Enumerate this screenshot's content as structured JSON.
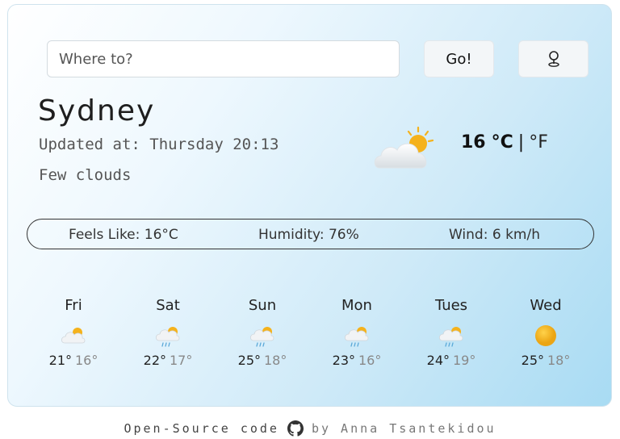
{
  "search": {
    "placeholder": "Where to?",
    "go_label": "Go!",
    "location_icon": "map-pin-icon"
  },
  "current": {
    "city": "Sydney",
    "updated": "Updated at: Thursday 20:13",
    "description": "Few clouds",
    "icon": "partly-cloudy-icon",
    "temperature": "16",
    "unit_celsius": "°C",
    "separator": "|",
    "unit_fahrenheit": "°F"
  },
  "details": {
    "feels_like": "Feels Like: 16°C",
    "humidity": "Humidity: 76%",
    "wind": "Wind: 6 km/h"
  },
  "forecast": [
    {
      "day": "Fri",
      "max": "21°",
      "min": "16°",
      "icon": "partly-cloudy-icon"
    },
    {
      "day": "Sat",
      "max": "22°",
      "min": "17°",
      "icon": "rain-sun-icon"
    },
    {
      "day": "Sun",
      "max": "25°",
      "min": "18°",
      "icon": "rain-sun-icon"
    },
    {
      "day": "Mon",
      "max": "23°",
      "min": "16°",
      "icon": "rain-sun-icon"
    },
    {
      "day": "Tues",
      "max": "24°",
      "min": "19°",
      "icon": "rain-sun-icon"
    },
    {
      "day": "Wed",
      "max": "25°",
      "min": "18°",
      "icon": "sun-icon"
    }
  ],
  "footer": {
    "link_text": "Open-Source code",
    "author_text": "by Anna Tsantekidou",
    "icon": "github-icon"
  },
  "colors": {
    "sun": "#f5b21c",
    "cloud": "#e9edf0",
    "rain": "#5aa8d8",
    "card_gradient_end": "#a8dbf3"
  }
}
